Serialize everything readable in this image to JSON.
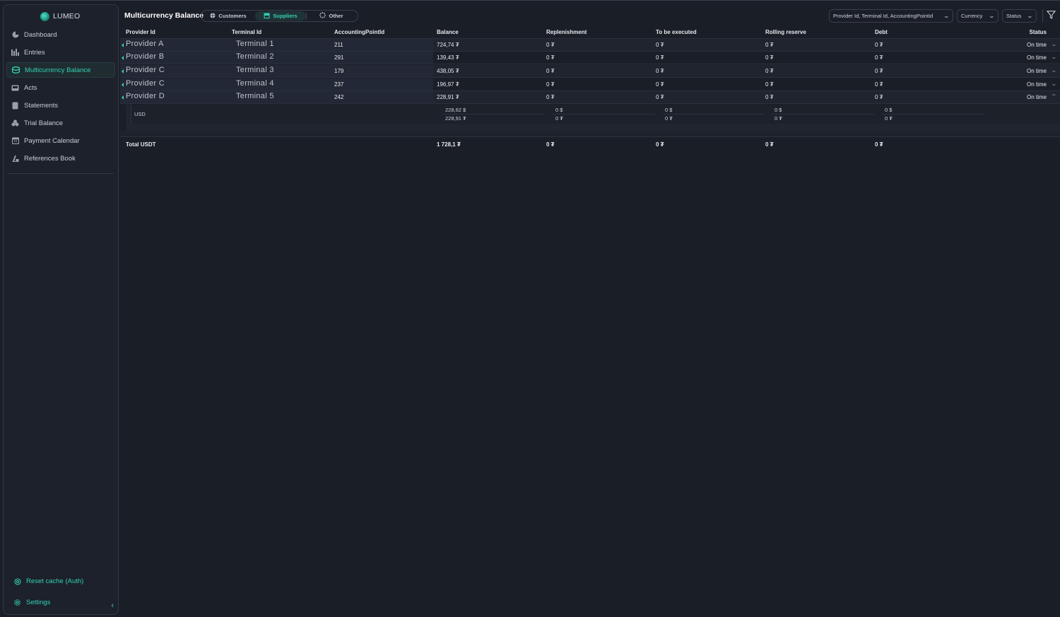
{
  "app": {
    "name": "LUMEO"
  },
  "sidebar": {
    "items": [
      {
        "label": "Dashboard",
        "icon": "pie-chart-icon"
      },
      {
        "label": "Entries",
        "icon": "bar-chart-icon"
      },
      {
        "label": "Multicurrency Balance",
        "icon": "coins-icon",
        "active": true
      },
      {
        "label": "Acts",
        "icon": "inbox-icon"
      },
      {
        "label": "Statements",
        "icon": "document-icon"
      },
      {
        "label": "Trial Balance",
        "icon": "stack-icon"
      },
      {
        "label": "Payment Calendar",
        "icon": "calendar-icon"
      },
      {
        "label": "References Book",
        "icon": "book-icon"
      }
    ],
    "reset_cache": "Reset cache (Auth)",
    "settings": "Settings"
  },
  "header": {
    "title": "Multicurrency Balance",
    "tabs": [
      {
        "label": "Customers",
        "icon": "globe-icon"
      },
      {
        "label": "Suppliers",
        "icon": "store-icon",
        "active": true
      },
      {
        "label": "Other",
        "icon": "dots-icon"
      }
    ],
    "group_select": "Provider Id, Terminal Id, AccountingPointId",
    "currency_select": "Currency",
    "status_select": "Status"
  },
  "table": {
    "columns": [
      "Provider Id",
      "Terminal Id",
      "AccountingPointId",
      "Balance",
      "Replenishment",
      "To be executed",
      "Rolling reserve",
      "Debt",
      "Status"
    ],
    "rows": [
      {
        "provider": "Provider A",
        "terminal": "Terminal 1",
        "point": "211",
        "balance": "724,74 ₮",
        "replenishment": "0 ₮",
        "to_execute": "0 ₮",
        "rolling": "0 ₮",
        "debt": "0 ₮",
        "status": "On time"
      },
      {
        "provider": "Provider B",
        "terminal": "Terminal 2",
        "point": "291",
        "balance": "139,43 ₮",
        "replenishment": "0 ₮",
        "to_execute": "0 ₮",
        "rolling": "0 ₮",
        "debt": "0 ₮",
        "status": "On time"
      },
      {
        "provider": "Provider C",
        "terminal": "Terminal 3",
        "point": "179",
        "balance": "438,05 ₮",
        "replenishment": "0 ₮",
        "to_execute": "0 ₮",
        "rolling": "0 ₮",
        "debt": "0 ₮",
        "status": "On time"
      },
      {
        "provider": "Provider C",
        "terminal": "Terminal 4",
        "point": "237",
        "balance": "196,97 ₮",
        "replenishment": "0 ₮",
        "to_execute": "0 ₮",
        "rolling": "0 ₮",
        "debt": "0 ₮",
        "status": "On time"
      },
      {
        "provider": "Provider D",
        "terminal": "Terminal 5",
        "point": "242",
        "balance": "228,91 ₮",
        "replenishment": "0 ₮",
        "to_execute": "0 ₮",
        "rolling": "0 ₮",
        "debt": "0 ₮",
        "status": "On time"
      }
    ],
    "expanded": {
      "currency": "USD",
      "balance": [
        "228,62 $",
        "228,91 ₮"
      ],
      "replenishment": [
        "0 $",
        "0 ₮"
      ],
      "to_execute": [
        "0 $",
        "0 ₮"
      ],
      "rolling": [
        "0 $",
        "0 ₮"
      ],
      "debt": [
        "0 $",
        "0 ₮"
      ]
    },
    "total": {
      "label": "Total USDT",
      "balance": "1 728,1 ₮",
      "replenishment": "0 ₮",
      "to_execute": "0 ₮",
      "rolling": "0 ₮",
      "debt": "0 ₮"
    }
  },
  "colors": {
    "accent": "#35d0b6",
    "background": "#1a1e27",
    "sidebar": "#1c212b"
  }
}
